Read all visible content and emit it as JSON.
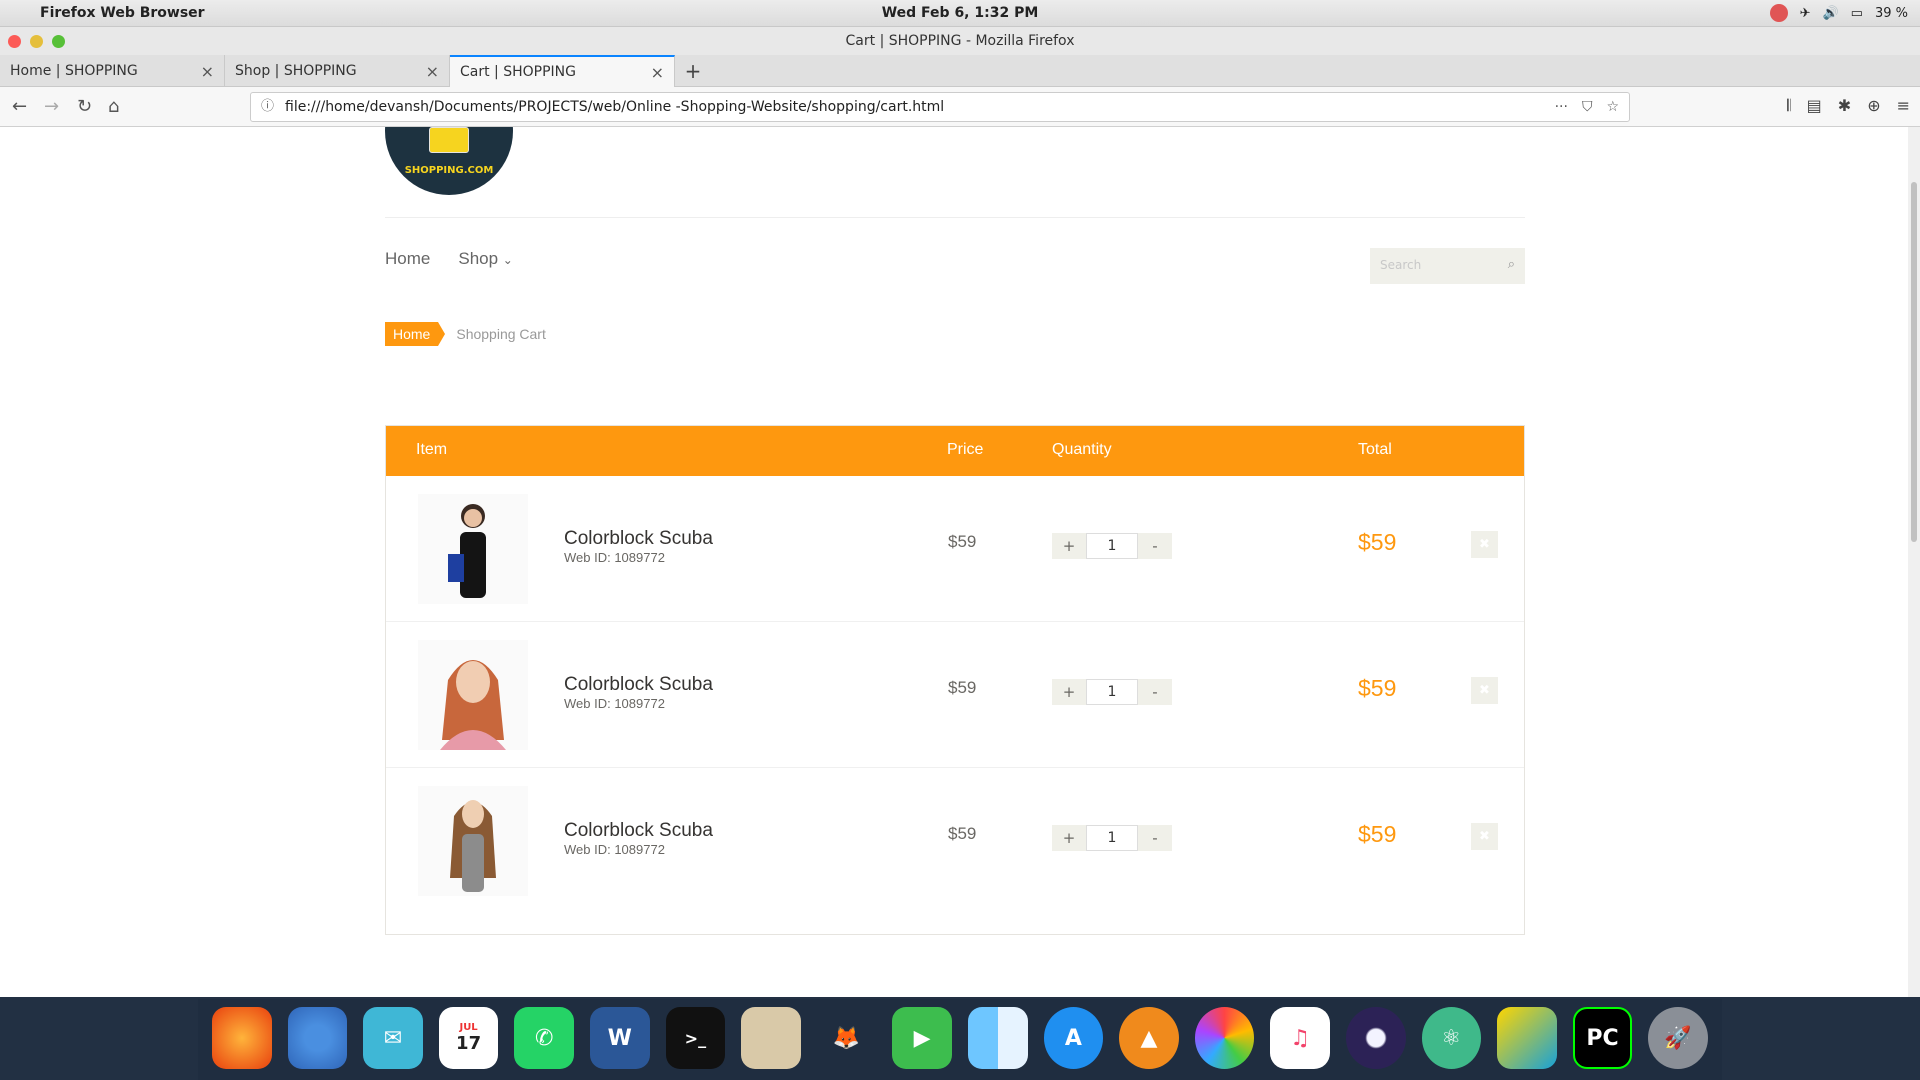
{
  "os": {
    "app_name": "Firefox Web Browser",
    "clock": "Wed Feb  6,  1:32 PM",
    "battery": "39 %"
  },
  "window": {
    "title": "Cart | SHOPPING - Mozilla Firefox"
  },
  "tabs": [
    {
      "label": "Home | SHOPPING"
    },
    {
      "label": "Shop | SHOPPING"
    },
    {
      "label": "Cart | SHOPPING"
    }
  ],
  "url": "file:///home/devansh/Documents/PROJECTS/web/Online -Shopping-Website/shopping/cart.html",
  "site": {
    "logo_text": "SHOPPING.COM",
    "menu": {
      "home": "Home",
      "shop": "Shop"
    },
    "search_placeholder": "Search"
  },
  "breadcrumb": {
    "home": "Home",
    "current": "Shopping Cart"
  },
  "cart": {
    "headers": {
      "item": "Item",
      "price": "Price",
      "quantity": "Quantity",
      "total": "Total"
    },
    "rows": [
      {
        "name": "Colorblock Scuba",
        "web_id": "Web ID: 1089772",
        "price": "$59",
        "qty": "1",
        "total": "$59"
      },
      {
        "name": "Colorblock Scuba",
        "web_id": "Web ID: 1089772",
        "price": "$59",
        "qty": "1",
        "total": "$59"
      },
      {
        "name": "Colorblock Scuba",
        "web_id": "Web ID: 1089772",
        "price": "$59",
        "qty": "1",
        "total": "$59"
      }
    ],
    "plus": "+",
    "minus": "-"
  },
  "colors": {
    "accent": "#fe980f",
    "dock": "#1f2d40"
  },
  "dock_icons": [
    "firefox-icon",
    "chromium-icon",
    "mail-icon",
    "calendar-icon",
    "whatsapp-icon",
    "word-icon",
    "terminal-icon",
    "calculator-icon",
    "gimp-icon",
    "facetime-icon",
    "finder-icon",
    "app-store-icon",
    "vlc-icon",
    "photos-icon",
    "music-icon",
    "eclipse-icon",
    "atom-icon",
    "sublime-icon",
    "pycharm-icon",
    "launchpad-icon"
  ],
  "dock_calendar": {
    "month": "JUL",
    "day": "17"
  },
  "dock_labels": {
    "word": "W",
    "pycharm": "PC"
  }
}
